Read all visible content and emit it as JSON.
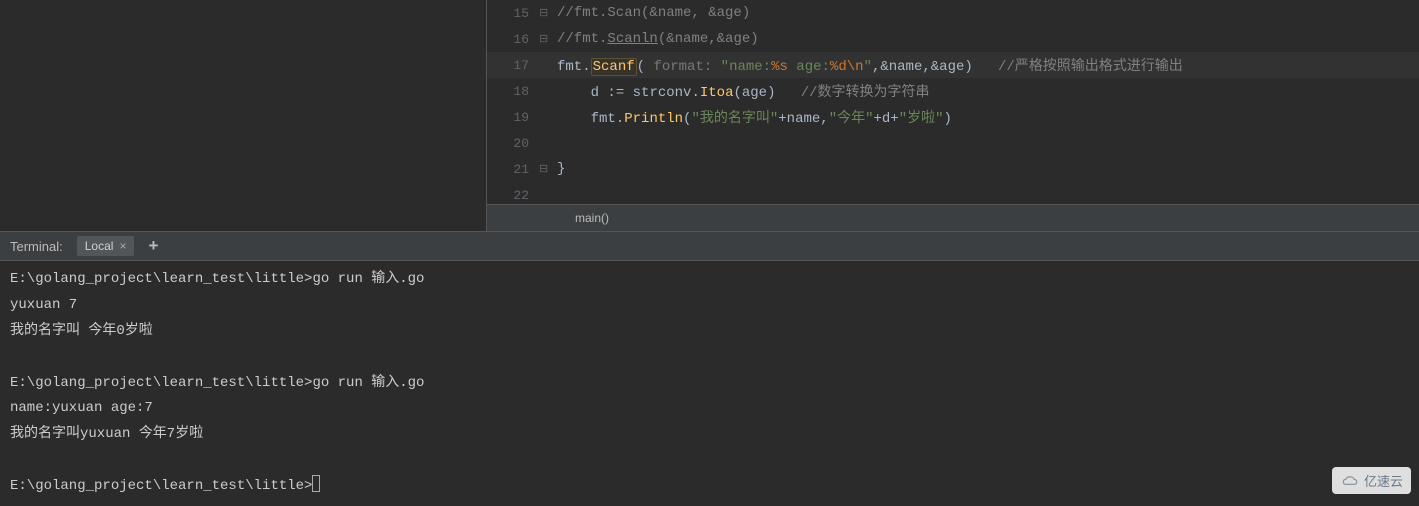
{
  "editor": {
    "lines": [
      {
        "num": "15",
        "fold": "⊟",
        "tokens": [
          {
            "t": "//fmt.Scan(&name, &age)",
            "c": "cm"
          }
        ],
        "indent": ""
      },
      {
        "num": "16",
        "fold": "⊟",
        "tokens": [
          {
            "t": "//fmt.",
            "c": "cm"
          },
          {
            "t": "Scanln",
            "c": "cm-u"
          },
          {
            "t": "(&name,&age)",
            "c": "cm"
          }
        ],
        "indent": ""
      },
      {
        "num": "17",
        "fold": "",
        "current": true,
        "tokens": [
          {
            "t": "fmt",
            "c": "pkg"
          },
          {
            "t": ".",
            "c": "op"
          },
          {
            "t": "Scanf",
            "c": "fn-bg"
          },
          {
            "t": "(",
            "c": "op"
          },
          {
            "t": " format: ",
            "c": "hint"
          },
          {
            "t": "\"name:",
            "c": "str"
          },
          {
            "t": "%s",
            "c": "fmt"
          },
          {
            "t": " age:",
            "c": "str"
          },
          {
            "t": "%d",
            "c": "fmt"
          },
          {
            "t": "\\n",
            "c": "fmt"
          },
          {
            "t": "\"",
            "c": "str"
          },
          {
            "t": ",&name,&age)",
            "c": "op"
          },
          {
            "t": "   ",
            "c": "op"
          },
          {
            "t": "//严格按照输出格式进行输出",
            "c": "num-c"
          }
        ],
        "indent": ""
      },
      {
        "num": "18",
        "fold": "",
        "tokens": [
          {
            "t": "    d ",
            "c": "id"
          },
          {
            "t": ":=",
            "c": "op"
          },
          {
            "t": " strconv",
            "c": "id"
          },
          {
            "t": ".",
            "c": "op"
          },
          {
            "t": "Itoa",
            "c": "fn"
          },
          {
            "t": "(age)",
            "c": "op"
          },
          {
            "t": "   ",
            "c": "op"
          },
          {
            "t": "//数字转换为字符串",
            "c": "num-c"
          }
        ],
        "indent": ""
      },
      {
        "num": "19",
        "fold": "",
        "tokens": [
          {
            "t": "    ",
            "c": "id"
          },
          {
            "t": "fmt",
            "c": "pkg"
          },
          {
            "t": ".",
            "c": "op"
          },
          {
            "t": "Println",
            "c": "fn"
          },
          {
            "t": "(",
            "c": "op"
          },
          {
            "t": "\"我的名字叫\"",
            "c": "str"
          },
          {
            "t": "+name,",
            "c": "op"
          },
          {
            "t": "\"今年\"",
            "c": "str"
          },
          {
            "t": "+d+",
            "c": "op"
          },
          {
            "t": "\"岁啦\"",
            "c": "str"
          },
          {
            "t": ")",
            "c": "op"
          }
        ],
        "indent": ""
      },
      {
        "num": "20",
        "fold": "",
        "tokens": [],
        "indent": ""
      },
      {
        "num": "21",
        "fold": "⊟",
        "tokens": [
          {
            "t": "}",
            "c": "op"
          }
        ],
        "indent": "",
        "closing": true
      },
      {
        "num": "22",
        "fold": "",
        "tokens": [],
        "indent": ""
      }
    ],
    "breadcrumb": "main()"
  },
  "terminal": {
    "title": "Terminal:",
    "tab_label": "Local",
    "add_label": "+",
    "output": "E:\\golang_project\\learn_test\\little>go run 输入.go\nyuxuan 7\n我的名字叫 今年0岁啦\n\nE:\\golang_project\\learn_test\\little>go run 输入.go\nname:yuxuan age:7\n我的名字叫yuxuan 今年7岁啦\n\nE:\\golang_project\\learn_test\\little>"
  },
  "watermark": "亿速云"
}
